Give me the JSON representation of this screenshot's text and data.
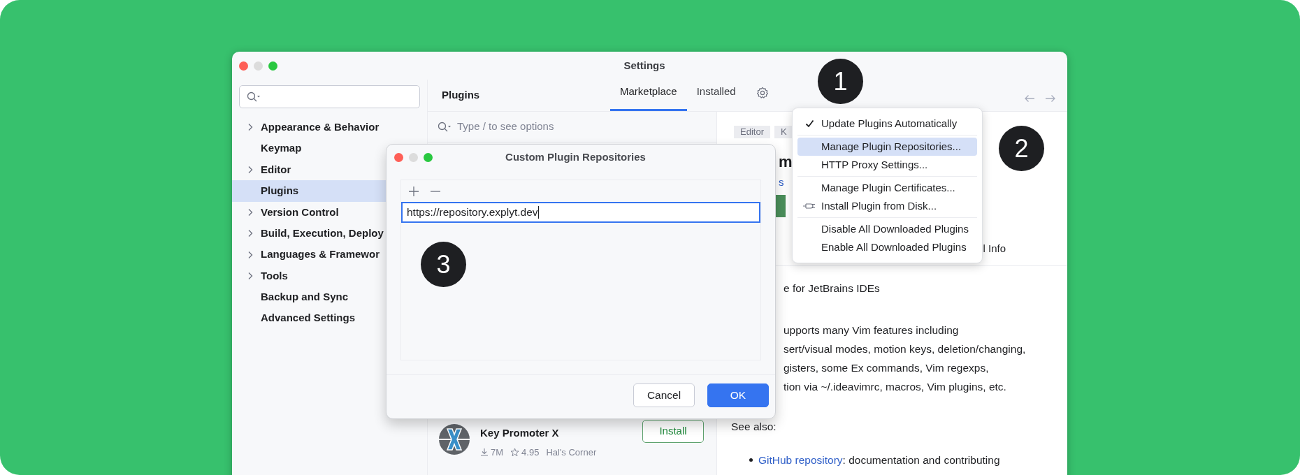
{
  "window": {
    "title": "Settings"
  },
  "sidebar": {
    "items": [
      {
        "label": "Appearance & Behavior",
        "expandable": true,
        "selected": false
      },
      {
        "label": "Keymap",
        "expandable": false,
        "selected": false
      },
      {
        "label": "Editor",
        "expandable": true,
        "selected": false
      },
      {
        "label": "Plugins",
        "expandable": false,
        "selected": true
      },
      {
        "label": "Version Control",
        "expandable": true,
        "selected": false
      },
      {
        "label": "Build, Execution, Deploy",
        "expandable": true,
        "selected": false
      },
      {
        "label": "Languages & Framewor",
        "expandable": true,
        "selected": false
      },
      {
        "label": "Tools",
        "expandable": true,
        "selected": false
      },
      {
        "label": "Backup and Sync",
        "expandable": false,
        "selected": false
      },
      {
        "label": "Advanced Settings",
        "expandable": false,
        "selected": false
      }
    ]
  },
  "plugins_header": {
    "title": "Plugins",
    "tabs": [
      {
        "label": "Marketplace",
        "selected": true
      },
      {
        "label": "Installed",
        "selected": false
      }
    ]
  },
  "plugin_search": {
    "placeholder": "Type / to see options"
  },
  "plugin_list": [
    {
      "name": "Key Promoter X",
      "downloads": "7M",
      "rating": "4.95",
      "vendor": "Hal's Corner",
      "button": "Install"
    }
  ],
  "detail": {
    "tags": [
      "Editor",
      "K"
    ],
    "title": "m",
    "link": "s",
    "tab": "l Info",
    "description": [
      "e for JetBrains IDEs",
      "upports many Vim features including",
      "sert/visual modes, motion keys, deletion/changing,",
      "gisters, some Ex commands, Vim regexps,",
      "tion via ~/.ideavimrc, macros, Vim plugins, etc."
    ],
    "see_also": "See also:",
    "bullets": [
      {
        "link": "GitHub repository",
        "text": ": documentation and contributing"
      }
    ]
  },
  "settings_menu": {
    "groups": [
      [
        {
          "label": "Update Plugins Automatically",
          "kind": "plain",
          "checked": true,
          "selected": false
        }
      ],
      [
        {
          "label": "Manage Plugin Repositories...",
          "kind": "plain",
          "checked": false,
          "selected": true
        },
        {
          "label": "HTTP Proxy Settings...",
          "kind": "plain",
          "checked": false,
          "selected": false
        }
      ],
      [
        {
          "label": "Manage Plugin Certificates...",
          "kind": "plain",
          "checked": false,
          "selected": false
        },
        {
          "label": "Install Plugin from Disk...",
          "kind": "plug",
          "checked": false,
          "selected": false
        }
      ],
      [
        {
          "label": "Disable All Downloaded Plugins",
          "kind": "plain",
          "checked": false,
          "selected": false
        },
        {
          "label": "Enable All Downloaded Plugins",
          "kind": "plain",
          "checked": false,
          "selected": false
        }
      ]
    ]
  },
  "dialog": {
    "title": "Custom Plugin Repositories",
    "repositories": [
      {
        "url": "https://repository.explyt.dev",
        "editing": true
      }
    ],
    "buttons": [
      {
        "label": "Cancel",
        "kind": "secondary"
      },
      {
        "label": "OK",
        "kind": "primary"
      }
    ]
  },
  "step_badges": [
    {
      "label": "1"
    },
    {
      "label": "2"
    },
    {
      "label": "3"
    }
  ]
}
